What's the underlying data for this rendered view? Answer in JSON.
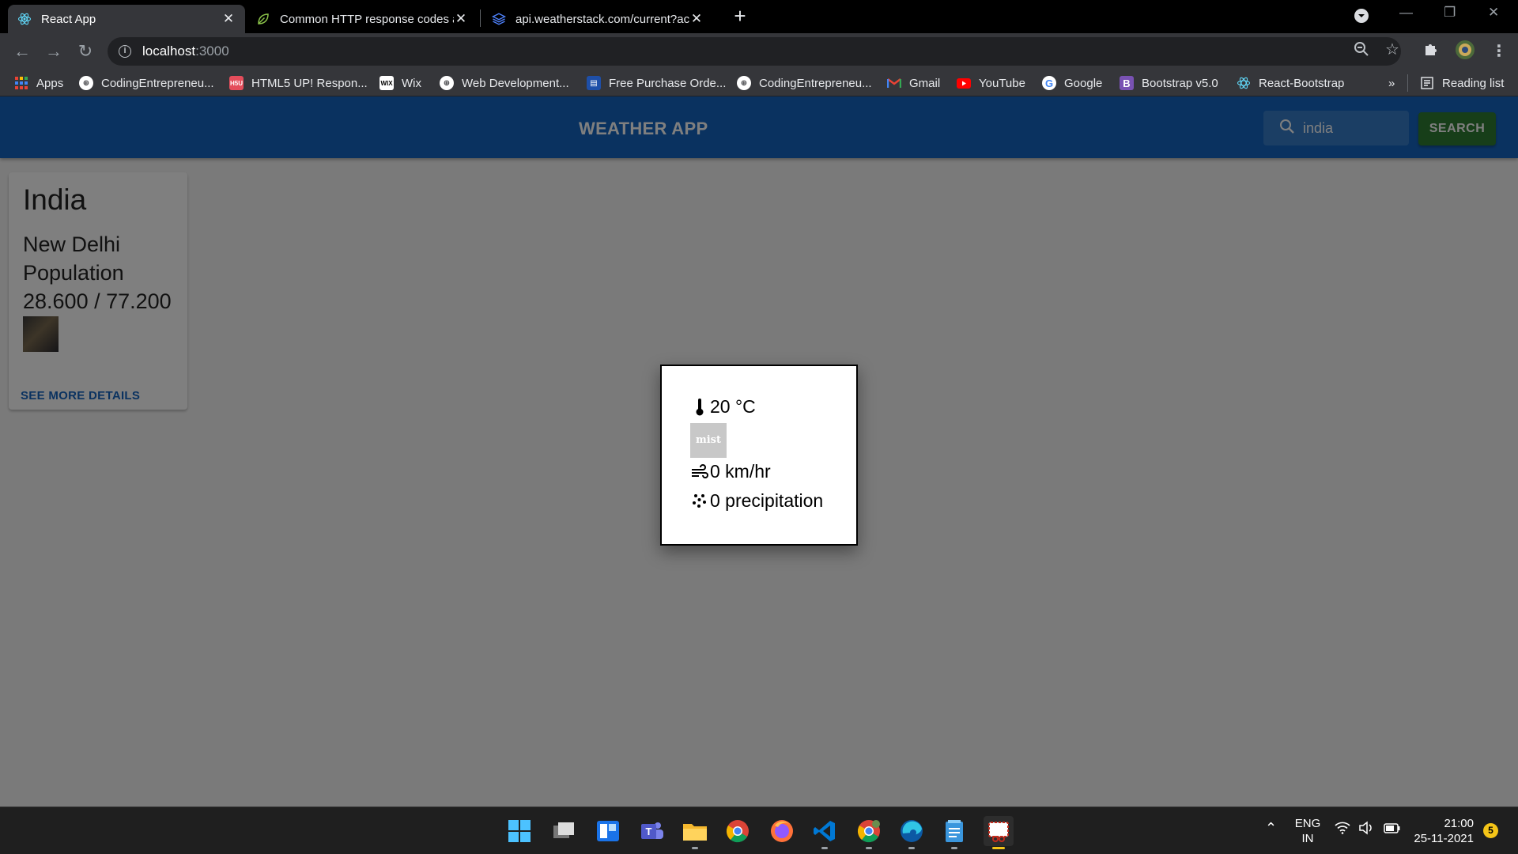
{
  "browser": {
    "tabs": [
      {
        "title": "React App",
        "icon": "react-icon",
        "active": true
      },
      {
        "title": "Common HTTP response codes a",
        "icon": "leaf-icon",
        "active": false
      },
      {
        "title": "api.weatherstack.com/current?ac",
        "icon": "stack-icon",
        "active": false
      }
    ],
    "address": {
      "host": "localhost",
      "port": ":3000"
    },
    "bookmarks": [
      {
        "label": "Apps",
        "icon": "apps-grid-icon"
      },
      {
        "label": "CodingEntrepreneu...",
        "icon": "globe-icon"
      },
      {
        "label": "HTML5 UP! Respon...",
        "icon": "html5up-icon"
      },
      {
        "label": "Wix",
        "icon": "wix-icon"
      },
      {
        "label": "Web Development...",
        "icon": "globe-icon"
      },
      {
        "label": "Free Purchase Orde...",
        "icon": "document-icon"
      },
      {
        "label": "CodingEntrepreneu...",
        "icon": "globe-icon"
      },
      {
        "label": "Gmail",
        "icon": "gmail-icon"
      },
      {
        "label": "YouTube",
        "icon": "youtube-icon"
      },
      {
        "label": "Google",
        "icon": "google-icon"
      },
      {
        "label": "Bootstrap v5.0",
        "icon": "bootstrap-icon"
      },
      {
        "label": "React-Bootstrap",
        "icon": "react-bootstrap-icon"
      }
    ],
    "reading_list": "Reading list"
  },
  "app": {
    "title": "WEATHER APP",
    "search": {
      "value": "india",
      "placeholder": "Search…"
    },
    "search_button": "SEARCH",
    "colors": {
      "appbar": "#1565c0",
      "search_button": "#2e7d32"
    }
  },
  "card": {
    "country": "India",
    "capital": "New Delhi",
    "population_label": "Population",
    "latlng": "28.600 / 77.200",
    "more_button": "SEE MORE DETAILS"
  },
  "weather_modal": {
    "temperature": "20 °C",
    "condition_icon_text": "mist",
    "wind": "0 km/hr",
    "precipitation": "0 precipitation"
  },
  "taskbar": {
    "language": {
      "line1": "ENG",
      "line2": "IN"
    },
    "time": "21:00",
    "date": "25-11-2021",
    "notification_count": "5"
  }
}
